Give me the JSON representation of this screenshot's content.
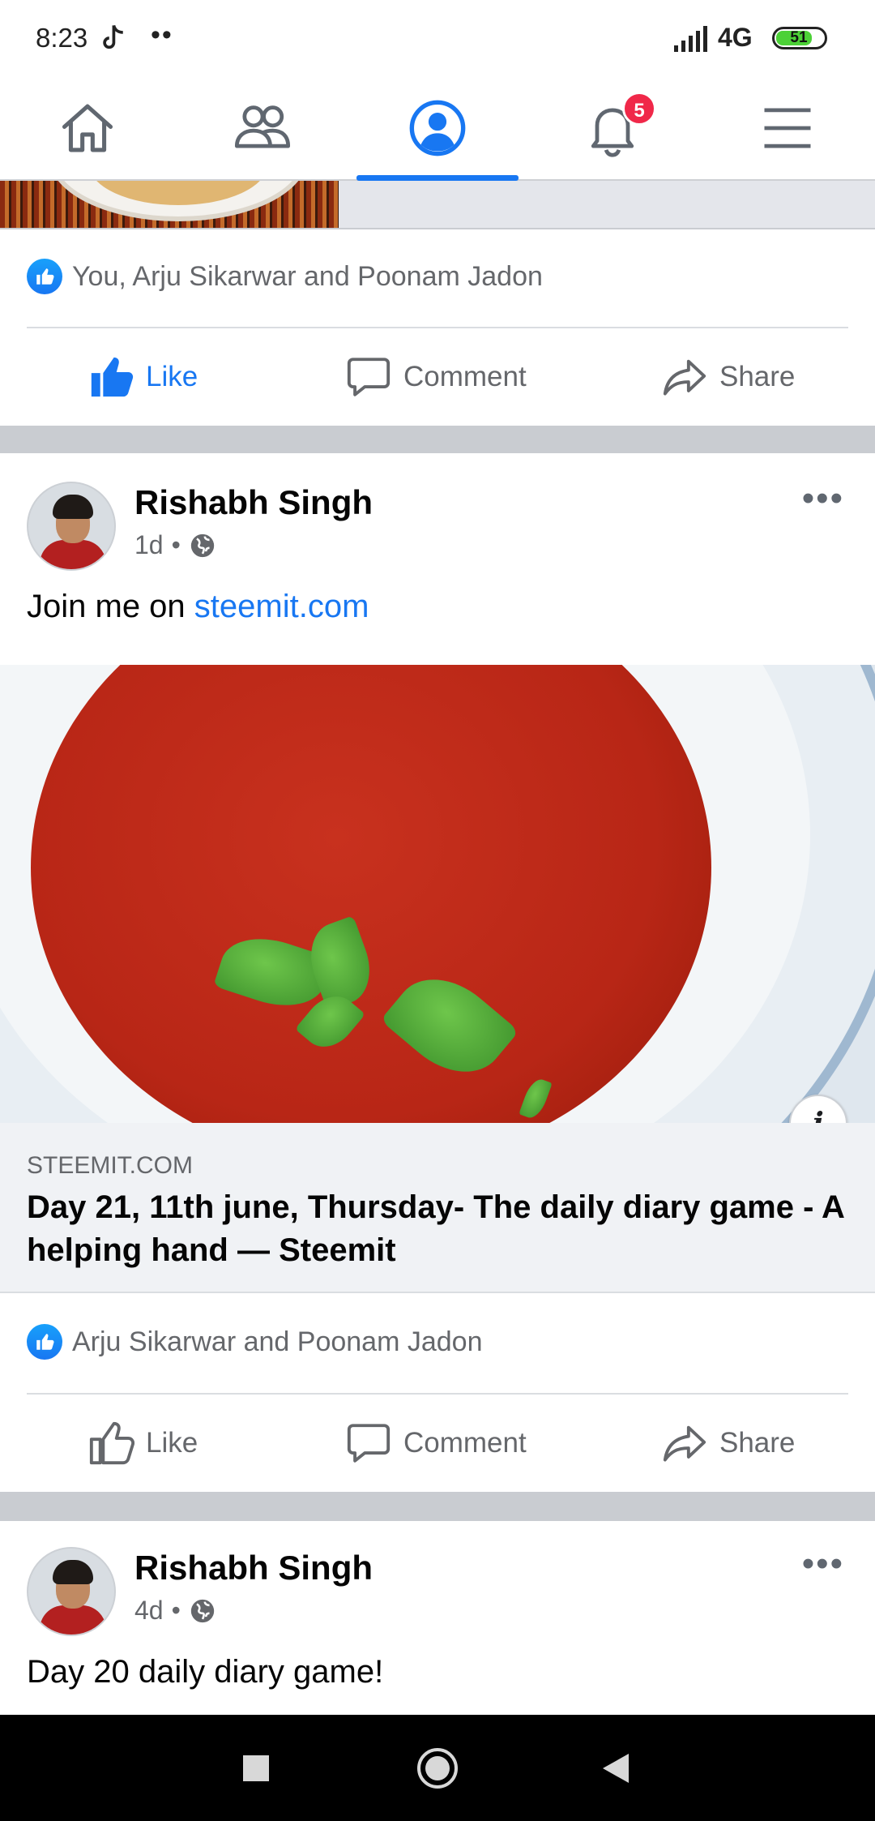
{
  "status_bar": {
    "time": "8:23",
    "dots": "••",
    "network": "4G",
    "battery": "51"
  },
  "nav": {
    "items": [
      {
        "name": "home",
        "icon": "home-icon"
      },
      {
        "name": "friends",
        "icon": "friends-icon"
      },
      {
        "name": "profile",
        "icon": "profile-icon",
        "active": true
      },
      {
        "name": "notifications",
        "icon": "bell-icon",
        "badge": "5"
      },
      {
        "name": "menu",
        "icon": "hamburger-menu-icon"
      }
    ],
    "notifications_badge": "5",
    "accent_color": "#1877f2"
  },
  "posts": [
    {
      "reactions_text": "You, Arju Sikarwar and Poonam Jadon",
      "actions": {
        "like": "Like",
        "comment": "Comment",
        "share": "Share"
      },
      "liked": true
    },
    {
      "author": "Rishabh Singh",
      "time": "1d",
      "separator": "•",
      "text_prefix": "Join me on ",
      "text_link": "steemit.com",
      "link_preview": {
        "info_icon": "i",
        "domain": "STEEMIT.COM",
        "title": "Day 21, 11th june, Thursday- The daily diary game - A helping hand — Steemit"
      },
      "reactions_text": "Arju Sikarwar and Poonam Jadon",
      "actions": {
        "like": "Like",
        "comment": "Comment",
        "share": "Share"
      },
      "liked": false
    },
    {
      "author": "Rishabh Singh",
      "time": "4d",
      "separator": "•",
      "text": "Day 20 daily diary game!"
    }
  ]
}
